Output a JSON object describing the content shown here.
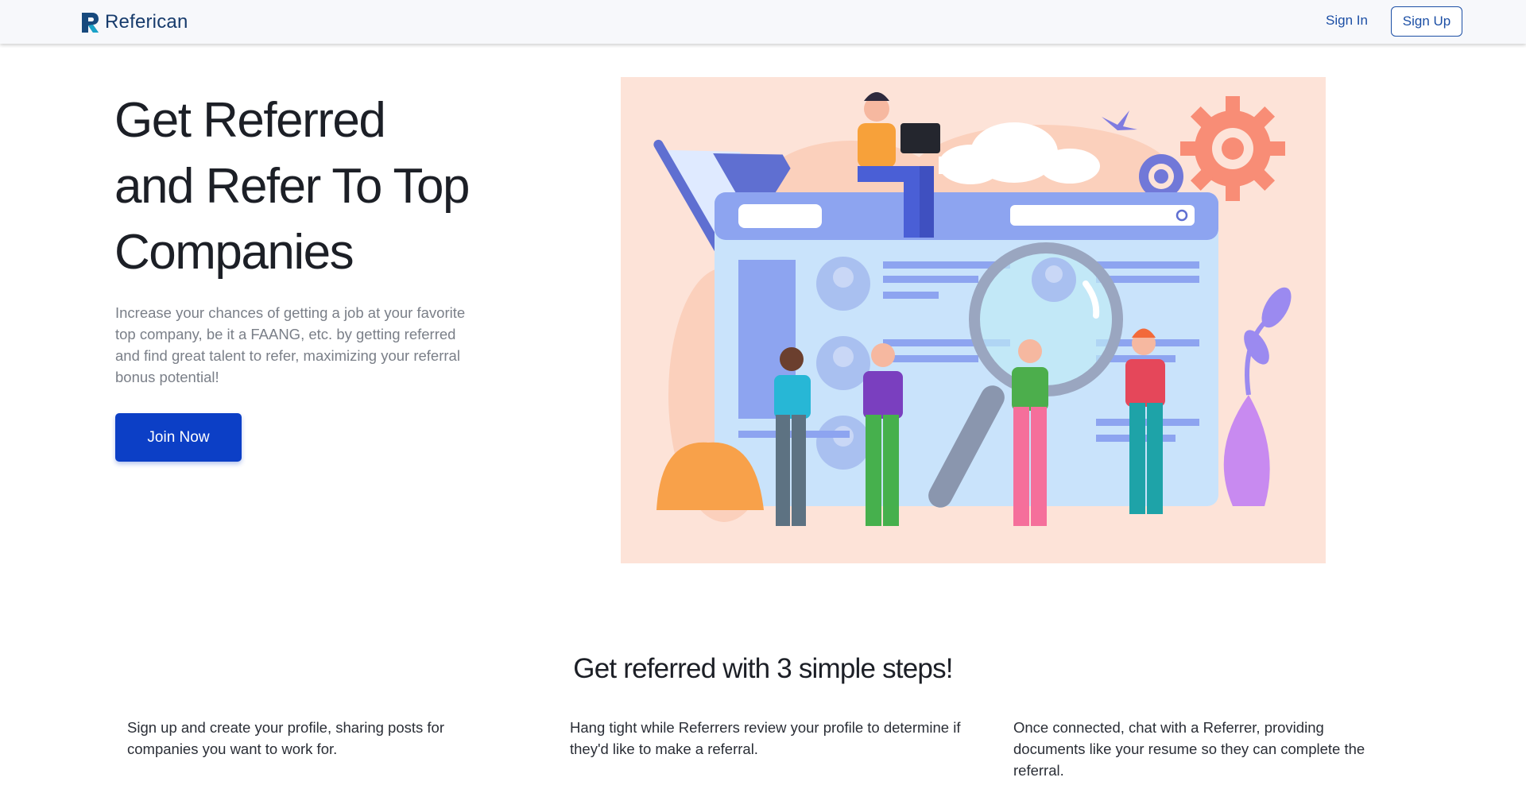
{
  "header": {
    "brand_name": "Referican",
    "sign_in_label": "Sign In",
    "sign_up_label": "Sign Up"
  },
  "hero": {
    "title_lines": [
      "Get Referred",
      "and Refer To Top",
      "Companies"
    ],
    "description": "Increase your chances of getting a job at your favorite top company, be it a FAANG, etc. by getting referred and find great talent to refer, maximizing your referral bonus potential!",
    "cta_label": "Join Now"
  },
  "steps": {
    "heading": "Get referred with 3 simple steps!",
    "items": [
      "Sign up and create your profile, sharing posts for companies you want to work for.",
      "Hang tight while Referrers review your profile to determine if they'd like to make a referral.",
      "Once connected, chat with a Referrer, providing documents like your resume so they can complete the referral."
    ]
  },
  "colors": {
    "primary": "#0c3fc6",
    "link": "#1c4fa5",
    "illustration_bg": "#fde3d8"
  }
}
